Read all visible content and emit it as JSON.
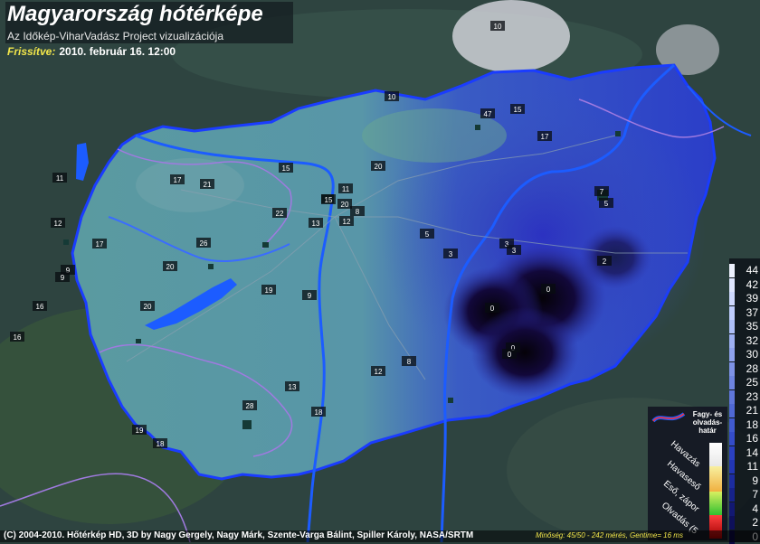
{
  "header": {
    "title": "Magyarország hótérképe",
    "subtitle": "Az Időkép-ViharVadász Project vizualizációja",
    "updated_label": "Frissítve:",
    "updated_value": "2010. február 16. 12:00"
  },
  "footer": {
    "copyright": "(C) 2004-2010. Hőtérkép HD, 3D by Nagy Gergely, Nagy Márk, Szente-Varga Bálint, Spiller Károly, NASA/SRTM",
    "quality": "Minőség: 45/50 - 242 mérés, Gentime= 16 ms"
  },
  "scale": {
    "ticks": [
      "44",
      "42",
      "39",
      "37",
      "35",
      "32",
      "30",
      "28",
      "25",
      "23",
      "21",
      "18",
      "16",
      "14",
      "11",
      "9",
      "7",
      "4",
      "2",
      "0"
    ]
  },
  "legend": {
    "frost_line": [
      "Fagy- és",
      "olvadás-",
      "határ"
    ],
    "categories": [
      "Havazás",
      "Havaseső",
      "Eső, zápor",
      "Olvadás (5"
    ]
  },
  "stations": [
    "10",
    "10",
    "47",
    "15",
    "17",
    "15",
    "17",
    "21",
    "20",
    "11",
    "15",
    "20",
    "8",
    "22",
    "13",
    "12",
    "11",
    "12",
    "17",
    "26",
    "5",
    "3",
    "3",
    "3",
    "2",
    "9",
    "9",
    "20",
    "19",
    "9",
    "0",
    "0",
    "0",
    "0",
    "20",
    "16",
    "16",
    "12",
    "8",
    "13",
    "18",
    "28",
    "19",
    "18",
    "7",
    "5"
  ],
  "colors": {
    "snow_blue": "#2a3fc8",
    "deep_snow": "#0a0418",
    "water": "#1c5cff",
    "frost_line": "#ff3030"
  }
}
